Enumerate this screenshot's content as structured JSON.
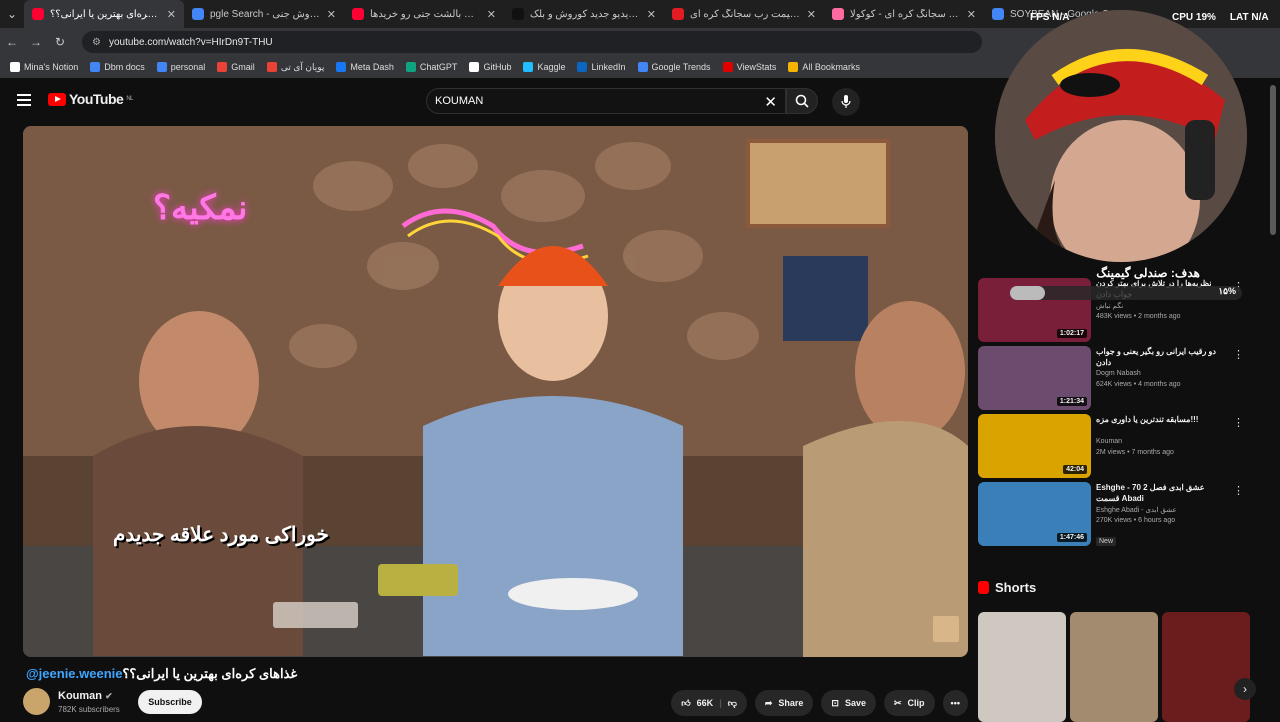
{
  "browser": {
    "tabs": [
      {
        "title": "غذاهای کره‌ای بهترین یا ایرانی؟؟",
        "color": "#ff0033",
        "active": true
      },
      {
        "title": "pgle Search - بالش کوروش جنی",
        "color": "#4285f4",
        "active": false
      },
      {
        "title": "کوروش بالشت جنی رو خریدها",
        "color": "#ff0033",
        "active": false
      },
      {
        "title": "موزیک ویدیو جدید کوروش و بلک",
        "color": "#111111",
        "active": false
      },
      {
        "title": "خرید و قیمت رب سجانگ کره ای",
        "color": "#e31b23",
        "active": false
      },
      {
        "title": "رب سجانگ کره ای - کوکولا",
        "color": "#ff6aa0",
        "active": false
      },
      {
        "title": "SOYBEAN - Google Search",
        "color": "#4285f4",
        "active": false
      }
    ],
    "url": "youtube.com/watch?v=HIrDn9T-THU",
    "bookmarks": [
      {
        "label": "Mina's Notion",
        "color": "#ffffff"
      },
      {
        "label": "Dbm docs",
        "color": "#4285f4"
      },
      {
        "label": "personal",
        "color": "#4285f4"
      },
      {
        "label": "Gmail",
        "color": "#ea4335"
      },
      {
        "label": "پویان آی تی",
        "color": "#ea4335"
      },
      {
        "label": "Meta Dash",
        "color": "#1877f2"
      },
      {
        "label": "ChatGPT",
        "color": "#10a37f"
      },
      {
        "label": "GitHub",
        "color": "#ffffff"
      },
      {
        "label": "Kaggle",
        "color": "#20beff"
      },
      {
        "label": "LinkedIn",
        "color": "#0a66c2"
      },
      {
        "label": "Google Trends",
        "color": "#4285f4"
      },
      {
        "label": "ViewStats",
        "color": "#e00000"
      },
      {
        "label": "All Bookmarks",
        "color": "#f4b400"
      }
    ]
  },
  "overlay": {
    "fps_label": "FPS",
    "fps_value": "N/A",
    "cpu_label": "CPU",
    "cpu_value": "19%",
    "lat_label": "LAT",
    "lat_value": "N/A",
    "goal_text": "هدف: صندلی گیمینگ",
    "goal_percent": "۱۵%"
  },
  "header": {
    "logo": "YouTube",
    "region": "NL",
    "search_value": "KOUMAN"
  },
  "video": {
    "caption_top": "نمکیه؟",
    "caption_bottom": "خوراکی مورد علاقه جدیدم",
    "title": "غذاهای کره‌ای بهترین یا ایرانی؟؟",
    "title_handle": "@jeenie.weenie",
    "channel": "Kouman",
    "subscribers": "782K subscribers",
    "subscribe_label": "Subscribe",
    "likes": "66K",
    "share_label": "Share",
    "save_label": "Save",
    "clip_label": "Clip"
  },
  "recommendations": [
    {
      "title": "نظریه‌ها را در تلاش برای بهتر کردن جواب دادن",
      "channel": "نگم نباش",
      "meta": "483K views • 2 months ago",
      "duration": "1:02:17",
      "thumb": "#7a1f3a"
    },
    {
      "title": "دو رقیب ایرانی رو بگیر یعنی و جواب دادن",
      "channel": "Dogm Nabash",
      "meta": "624K views • 4 months ago",
      "duration": "1:21:34",
      "thumb": "#6b4b6e"
    },
    {
      "title": "مسابقه تندترین یا داوری مزه!!!",
      "channel": "Kouman",
      "meta": "2M views • 7 months ago",
      "duration": "42:04",
      "thumb": "#d9a400"
    },
    {
      "title": "Eshghe - 70 عشق ابدی فصل 2 قسمت Abadi",
      "channel": "Eshghe Abadi - عشق ابدی",
      "meta": "270K views • 6 hours ago",
      "duration": "1:47:46",
      "thumb": "#3b7fb8",
      "badge": "New"
    }
  ],
  "shorts": {
    "heading": "Shorts",
    "thumbs": [
      "#cfc8c0",
      "#a38b6f",
      "#6b1d1d"
    ]
  }
}
